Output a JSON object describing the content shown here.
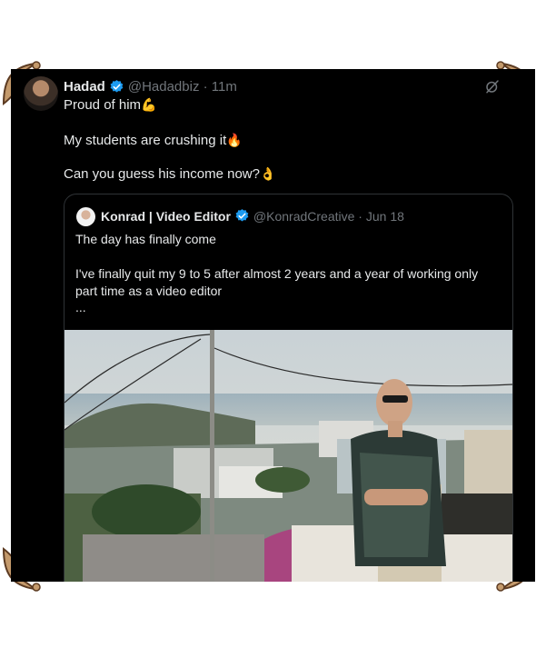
{
  "tweet": {
    "author_name": "Hadad",
    "author_handle": "@Hadadbiz",
    "time": "11m",
    "lines": [
      "Proud of him",
      "My students are crushing it",
      "Can you guess his income now?"
    ],
    "emojis": [
      "💪",
      "🔥",
      "👌"
    ]
  },
  "quote": {
    "author_name": "Konrad | Video Editor",
    "author_handle": "@KonradCreative",
    "date": "Jun 18",
    "line1": "The day has finally come",
    "line2": "I've finally quit my 9 to 5 after almost 2 years and a year of working only",
    "line3": "part time as a video editor",
    "ellipsis": "..."
  },
  "colors": {
    "background": "#000000",
    "text": "#e7e9ea",
    "muted": "#71767b",
    "verified": "#1d9bf0",
    "border": "#2f3336",
    "frame": "#c49a6c"
  },
  "icons": [
    "ornament-corner-icon",
    "verified-badge-icon",
    "grok-slash-icon"
  ]
}
